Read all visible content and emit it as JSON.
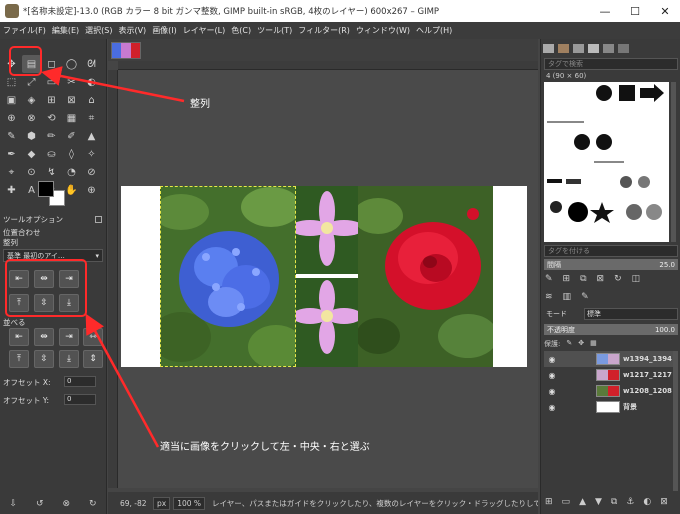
{
  "window": {
    "title": "*[名称未設定]-13.0 (RGB カラー 8 bit ガンマ整数, GIMP built-in sRGB, 4枚のレイヤー) 600x267 – GIMP",
    "minimize": "—",
    "maximize": "☐",
    "close": "✕"
  },
  "menu": [
    "ファイル(F)",
    "編集(E)",
    "選択(S)",
    "表示(V)",
    "画像(I)",
    "レイヤー(L)",
    "色(C)",
    "ツール(T)",
    "フィルター(R)",
    "ウィンドウ(W)",
    "ヘルプ(H)"
  ],
  "toolbox": {
    "tools": [
      "✥",
      "▤",
      "◻",
      "◯",
      "ᘛ",
      "⬚",
      "⤢",
      "▭",
      "✂",
      "◐",
      "▣",
      "◈",
      "⊞",
      "⊠",
      "⌂",
      "⊕",
      "⊗",
      "⟲",
      "▦",
      "⌗",
      "✎",
      "⬢",
      "✏",
      "✐",
      "▲",
      "✒",
      "◆",
      "⛀",
      "◊",
      "✧",
      "⌖",
      "⊙",
      "↯",
      "◔",
      "⊘",
      "✚",
      "A",
      "⚲",
      "✋",
      "⊕"
    ],
    "tool_options_tab": "ツールオプション",
    "section_title": "位置合わせ",
    "align_label": "整列",
    "relative_to": "基準 最初のアイ…",
    "distribute_label": "並べる",
    "offset_x_label": "オフセット X:",
    "offset_x_value": "0",
    "offset_y_label": "オフセット Y:",
    "offset_y_value": "0",
    "bottom_icons": [
      "⇩",
      "↺",
      "⊗",
      "↻"
    ]
  },
  "canvas": {
    "status_coords": "69, -82",
    "unit": "px",
    "zoom": "100 %",
    "status_message": "レイヤー、パスまたはガイドをクリックしたり、複数のレイヤーをクリック・ドラッグしたりして整列対象を選択します"
  },
  "dock": {
    "tag_search_placeholder": "タグで検索",
    "brush_info": "4 (90 × 60)",
    "tag_add_placeholder": "タグを付ける",
    "spacing_label": "間隔",
    "spacing_value": "25.0",
    "mode_label": "モード",
    "mode_value": "標準",
    "opacity_label": "不透明度",
    "opacity_value": "100.0",
    "lock_label": "保護:",
    "layers": [
      {
        "name": "w1394_1394",
        "active": true
      },
      {
        "name": "w1217_1217",
        "active": false
      },
      {
        "name": "w1208_1208",
        "active": false
      },
      {
        "name": "背景",
        "active": false
      }
    ]
  },
  "annotations": {
    "align_note": "整列",
    "click_note": "適当に画像をクリックして左・中央・右と選ぶ",
    "color": "#ff2a2a"
  }
}
